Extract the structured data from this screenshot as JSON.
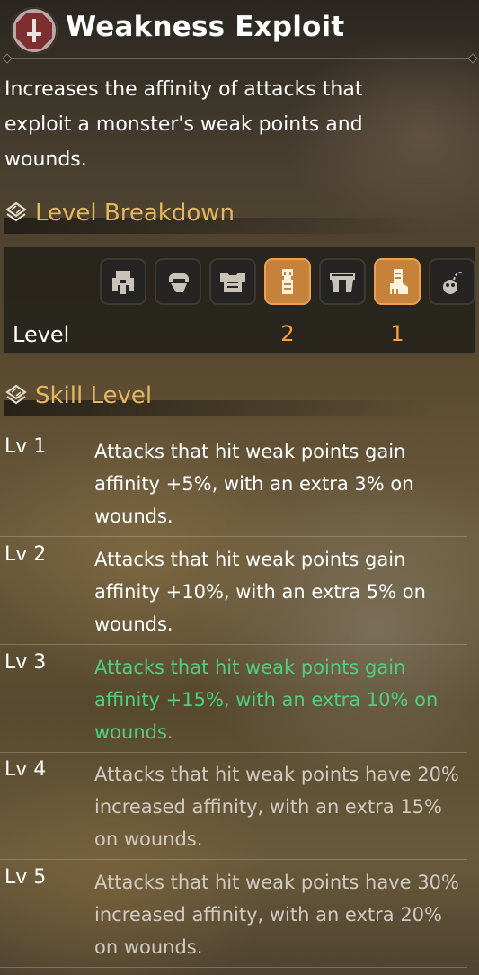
{
  "skill": {
    "title": "Weakness Exploit",
    "icon": "dagger-skill-icon",
    "description": "Increases the affinity of attacks that exploit a monster's weak points and wounds."
  },
  "breakdown": {
    "heading": "Level Breakdown",
    "level_label": "Level",
    "slots": [
      {
        "name": "weapon-icon",
        "active": false,
        "level": ""
      },
      {
        "name": "helm-icon",
        "active": false,
        "level": ""
      },
      {
        "name": "chest-armor-icon",
        "active": false,
        "level": ""
      },
      {
        "name": "arm-armor-icon",
        "active": true,
        "level": "2"
      },
      {
        "name": "waist-armor-icon",
        "active": false,
        "level": ""
      },
      {
        "name": "leg-armor-icon",
        "active": true,
        "level": "1"
      },
      {
        "name": "talisman-icon",
        "active": false,
        "level": ""
      }
    ]
  },
  "skill_levels": {
    "heading": "Skill Level",
    "levels": [
      {
        "label": "Lv 1",
        "text": "Attacks that hit weak points gain affinity +5%, with an extra 3% on wounds.",
        "state": "unlocked"
      },
      {
        "label": "Lv 2",
        "text": "Attacks that hit weak points gain affinity +10%, with an extra 5% on wounds.",
        "state": "unlocked"
      },
      {
        "label": "Lv 3",
        "text": "Attacks that hit weak points gain affinity +15%, with an extra 10% on wounds.",
        "state": "current"
      },
      {
        "label": "Lv 4",
        "text": "Attacks that hit weak points have 20% increased affinity, with an extra 15% on wounds.",
        "state": "locked"
      },
      {
        "label": "Lv 5",
        "text": "Attacks that hit weak points have 30% increased affinity, with an extra 20% on wounds.",
        "state": "locked"
      }
    ]
  },
  "colors": {
    "accent": "#e3b75e",
    "active_slot": "#c6823a",
    "level_number": "#ff9e3a",
    "current_level_text": "#4ed07c"
  }
}
